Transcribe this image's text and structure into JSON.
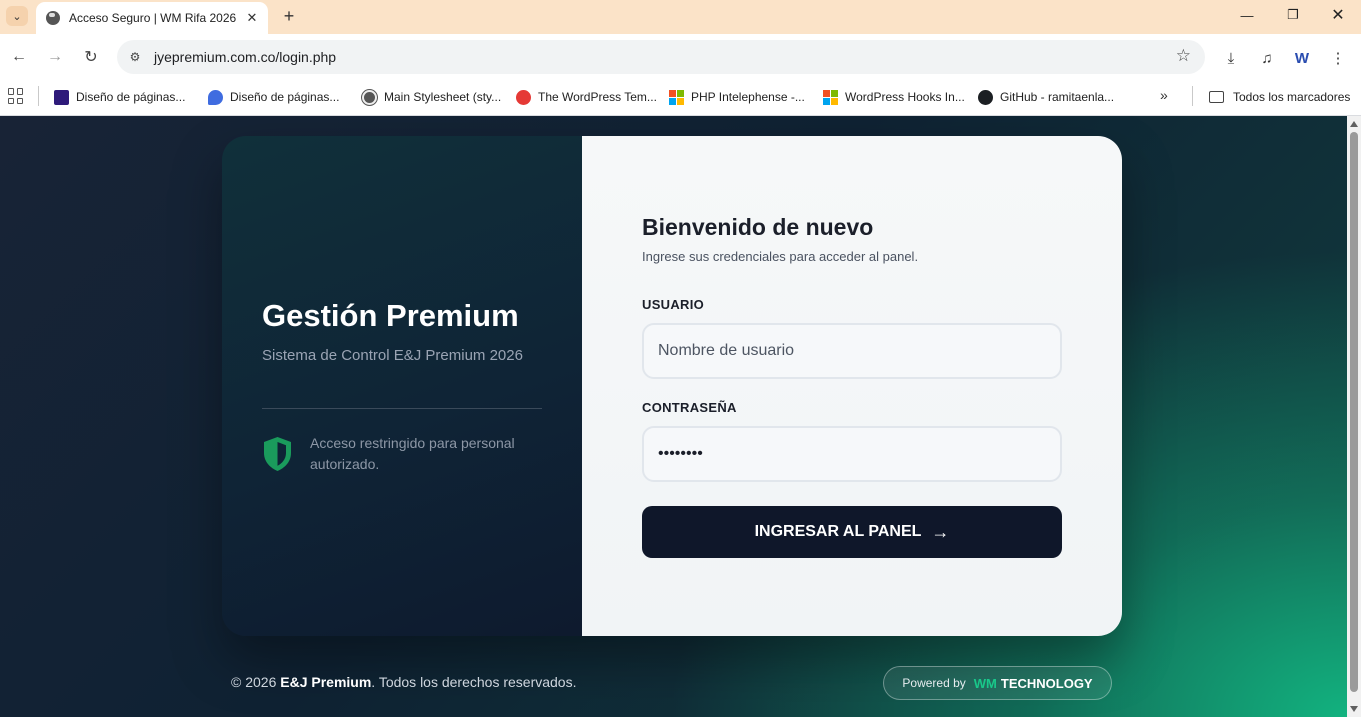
{
  "browser": {
    "tab_title": "Acceso Seguro | WM Rifa 2026",
    "url": "jyepremium.com.co/login.php",
    "bookmarks": [
      {
        "label": "Diseño de páginas...",
        "icon": "purple-square-icon"
      },
      {
        "label": "Diseño de páginas...",
        "icon": "blue-bubble-icon"
      },
      {
        "label": "Main Stylesheet (sty...",
        "icon": "wordpress-icon"
      },
      {
        "label": "The WordPress Tem...",
        "icon": "red-circle-icon"
      },
      {
        "label": "PHP Intelephense -...",
        "icon": "microsoft-icon"
      },
      {
        "label": "WordPress Hooks In...",
        "icon": "microsoft-icon"
      },
      {
        "label": "GitHub - ramitaenla...",
        "icon": "github-icon"
      }
    ],
    "all_bookmarks": "Todos los marcadores",
    "tabstrip_color": "#fbe3c8"
  },
  "brand": {
    "title": "Gestión Premium",
    "subtitle": "Sistema de Control E&J Premium 2026",
    "restricted": "Acceso restringido para personal autorizado.",
    "shield_color": "#1a9b5c"
  },
  "login": {
    "title": "Bienvenido de nuevo",
    "subtitle": "Ingrese sus credenciales para acceder al panel.",
    "user_label": "USUARIO",
    "user_placeholder": "Nombre de usuario",
    "password_label": "CONTRASEÑA",
    "password_value": "password",
    "submit_label": "INGRESAR AL PANEL",
    "submit_color": "#0f172a"
  },
  "footer": {
    "copyright_prefix": "© 2026 ",
    "copyright_brand": "E&J Premium",
    "copyright_suffix": ". Todos los derechos reservados.",
    "powered_by": "Powered by",
    "powered_wm": "WM",
    "powered_tech": "TECHNOLOGY",
    "accent_color": "#19c88a"
  }
}
